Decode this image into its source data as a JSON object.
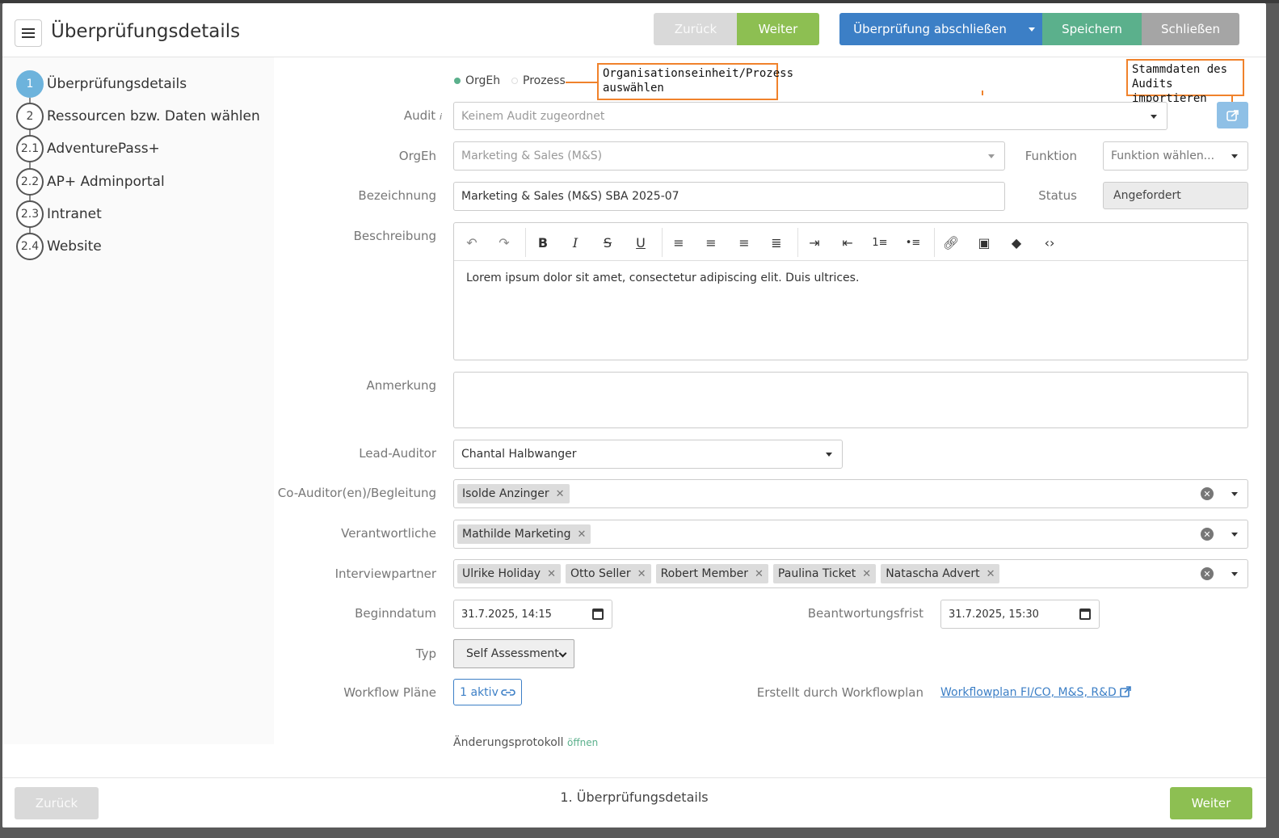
{
  "header": {
    "title": "Überprüfungsdetails",
    "back_label": "Zurück",
    "next_label": "Weiter",
    "finish_label": "Überprüfung abschließen",
    "save_label": "Speichern",
    "close_label": "Schließen"
  },
  "steps": [
    {
      "num": "1",
      "label": "Überprüfungsdetails",
      "active": true
    },
    {
      "num": "2",
      "label": "Ressourcen bzw. Daten wählen",
      "active": false
    },
    {
      "num": "2.1",
      "label": "AdventurePass+",
      "active": false
    },
    {
      "num": "2.2",
      "label": "AP+ Adminportal",
      "active": false
    },
    {
      "num": "2.3",
      "label": "Intranet",
      "active": false
    },
    {
      "num": "2.4",
      "label": "Website",
      "active": false
    }
  ],
  "form": {
    "scope": {
      "option1": "OrgEh",
      "option2": "Prozess",
      "selected": "OrgEh"
    },
    "callout_scope": "Organisationseinheit/Prozess auswählen",
    "callout_import": "Stammdaten des Audits importieren",
    "audit": {
      "label": "Audit",
      "info": "i",
      "placeholder": "Keinem Audit zugeordnet"
    },
    "orgeh": {
      "label": "OrgEh",
      "value": "Marketing & Sales (M&S)"
    },
    "funktion": {
      "label": "Funktion",
      "placeholder": "Funktion wählen..."
    },
    "bezeichnung": {
      "label": "Bezeichnung",
      "value": "Marketing & Sales (M&S) SBA 2025-07"
    },
    "status": {
      "label": "Status",
      "value": "Angefordert"
    },
    "beschreibung": {
      "label": "Beschreibung",
      "value": "Lorem ipsum dolor sit amet, consectetur adipiscing elit. Duis ultrices."
    },
    "anmerkung": {
      "label": "Anmerkung",
      "value": ""
    },
    "lead_auditor": {
      "label": "Lead-Auditor",
      "value": "Chantal Halbwanger"
    },
    "co_auditor": {
      "label": "Co-Auditor(en)/Begleitung",
      "tags": [
        "Isolde Anzinger"
      ]
    },
    "verantwortliche": {
      "label": "Verantwortliche",
      "tags": [
        "Mathilde Marketing"
      ]
    },
    "interviewpartner": {
      "label": "Interviewpartner",
      "tags": [
        "Ulrike Holiday",
        "Otto Seller",
        "Robert Member",
        "Paulina Ticket",
        "Natascha Advert"
      ]
    },
    "beginndatum": {
      "label": "Beginndatum",
      "value": "31.7.2025, 14:15"
    },
    "frist": {
      "label": "Beantwortungsfrist",
      "value": "31.7.2025, 15:30"
    },
    "typ": {
      "label": "Typ",
      "value": "Self Assessment"
    },
    "workflow": {
      "label": "Workflow Pläne",
      "button": "1 aktiv"
    },
    "erstellt": {
      "label": "Erstellt durch Workflowplan",
      "link": "Workflowplan FI/CO, M&S, R&D"
    },
    "log": {
      "label": "Änderungsprotokoll",
      "link": "öffnen"
    }
  },
  "footer": {
    "back_label": "Zurück",
    "step_label": "1. Überprüfungsdetails",
    "next_label": "Weiter"
  },
  "colors": {
    "primary": "#3c7fc6",
    "success": "#8dbf52",
    "save": "#5bb08c",
    "accent_callout": "#f0822b",
    "step_active": "#6db3dc"
  }
}
